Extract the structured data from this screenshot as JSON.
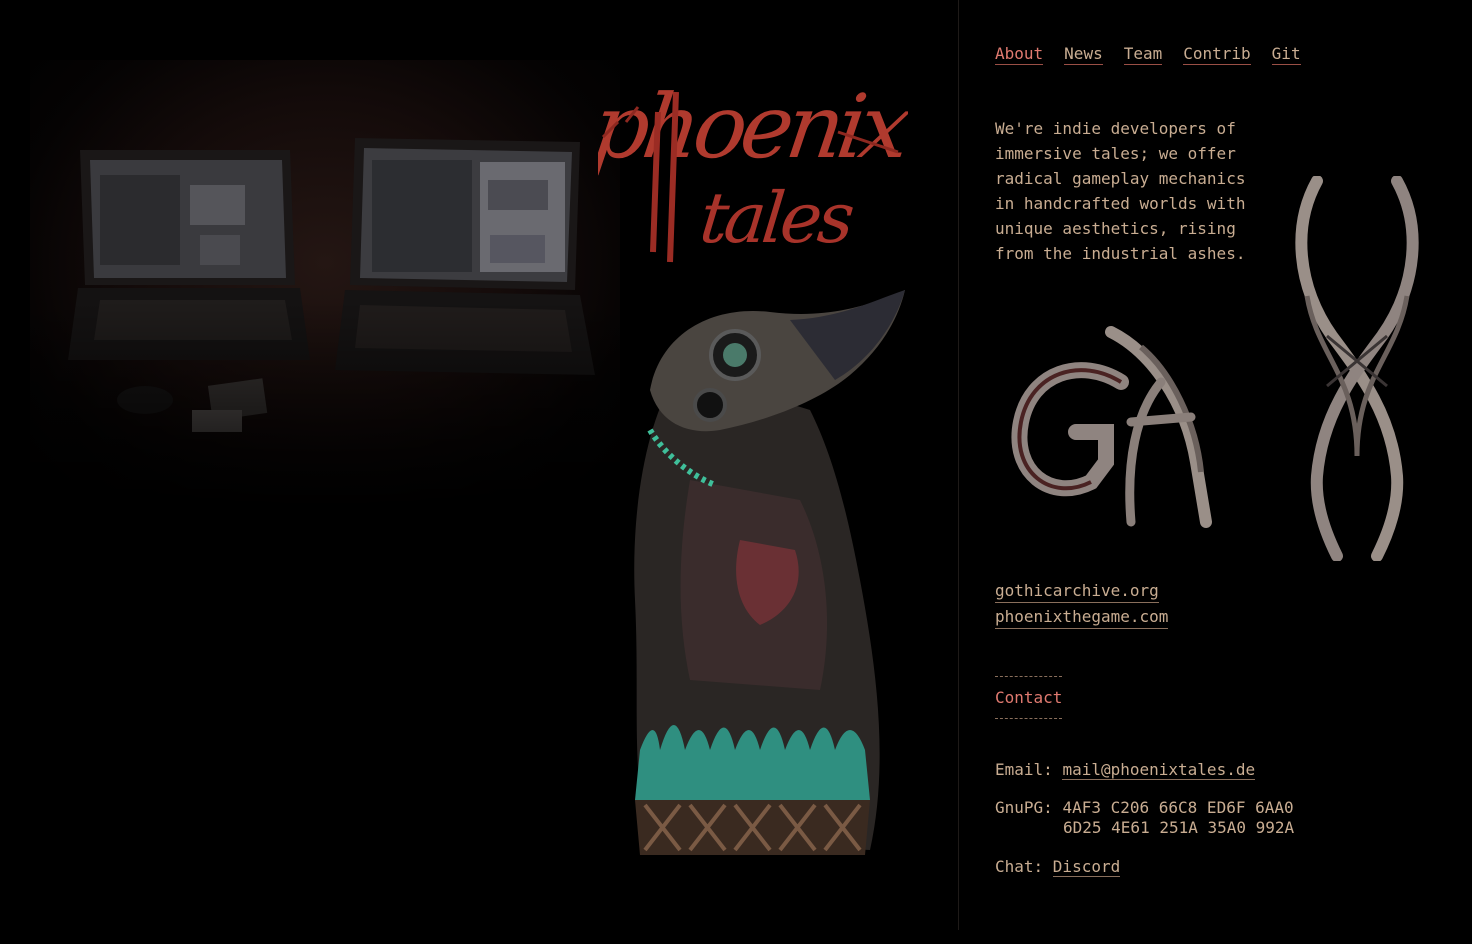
{
  "nav": {
    "items": [
      {
        "label": "About",
        "active": true
      },
      {
        "label": "News",
        "active": false
      },
      {
        "label": "Team",
        "active": false
      },
      {
        "label": "Contrib",
        "active": false
      },
      {
        "label": "Git",
        "active": false
      }
    ]
  },
  "intro": {
    "text": "We're indie developers of\nimmersive tales; we offer\nradical gameplay mechanics\nin handcrafted worlds with\nunique aesthetics, rising\nfrom the industrial ashes."
  },
  "art": {
    "logo_text": "phoenix tales",
    "monogram_text": "GAM"
  },
  "links": {
    "site1": "gothicarchive.org",
    "site2": "phoenixthegame.com"
  },
  "contact": {
    "heading": "Contact",
    "email_label": "Email: ",
    "email_value": "mail@phoenixtales.de",
    "gnupg_label": "GnuPG: ",
    "gnupg_line1": "4AF3 C206 66C8 ED6F 6AA0",
    "gnupg_line2": "6D25 4E61 251A 35A0 992A",
    "chat_label": "Chat: ",
    "chat_value": "Discord"
  },
  "colors": {
    "background": "#000000",
    "text": "#c9ad92",
    "accent": "#e07a70",
    "logo_red": "#b03a2e"
  }
}
